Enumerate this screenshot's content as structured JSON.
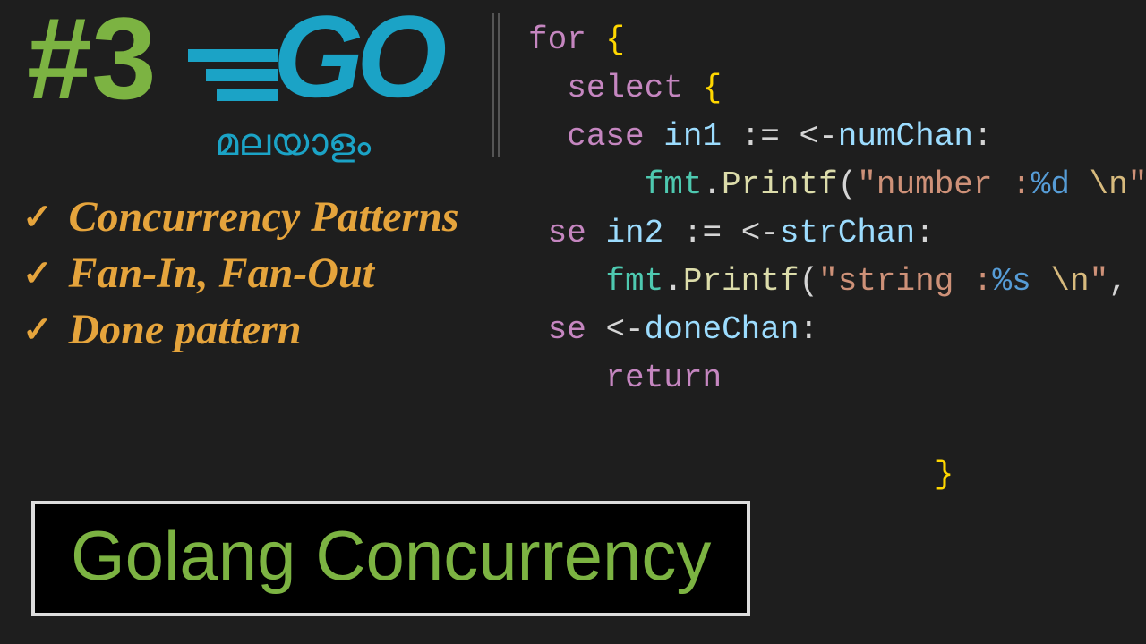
{
  "episode": "#3",
  "logo_text": "GO",
  "subtitle_ml": "മലയാളം",
  "bullets": [
    "Concurrency Patterns",
    "Fan-In, Fan-Out",
    "Done pattern"
  ],
  "title": "Golang Concurrency",
  "code": {
    "l1_for": "for",
    "l1_brace": "{",
    "l2_select": "select",
    "l2_brace": "{",
    "l3_case": "case",
    "l3_ident": "in1",
    "l3_assign": ":=",
    "l3_arrow": "<-",
    "l3_chan": "numChan",
    "l3_colon": ":",
    "l4_pkg": "fmt",
    "l4_dot": ".",
    "l4_func": "Printf",
    "l4_paren": "(",
    "l4_q1": "\"",
    "l4_str1": "number :",
    "l4_pct": "%d",
    "l4_sp": " ",
    "l4_esc": "\\n",
    "l4_q2": "\"",
    "l4_comma": ",",
    "l5_case": "se",
    "l5_ident": "in2",
    "l5_assign": ":=",
    "l5_arrow": "<-",
    "l5_chan": "strChan",
    "l5_colon": ":",
    "l6_pkg": "fmt",
    "l6_dot": ".",
    "l6_func": "Printf",
    "l6_paren": "(",
    "l6_q1": "\"",
    "l6_str1": "string :",
    "l6_pct": "%s",
    "l6_sp": " ",
    "l6_esc": "\\n",
    "l6_q2": "\"",
    "l6_comma": ",",
    "l7_case": "se",
    "l7_arrow": "<-",
    "l7_chan": "doneChan",
    "l7_colon": ":",
    "l8_return": "return",
    "l9_brace": "}"
  }
}
